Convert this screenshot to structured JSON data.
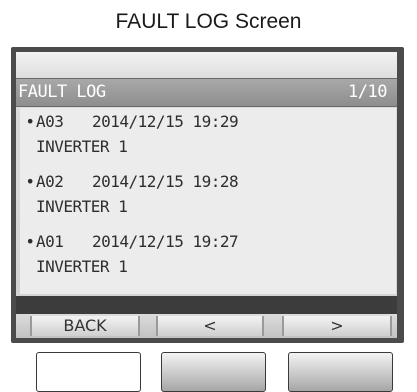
{
  "caption": "FAULT LOG Screen",
  "title_bar": {
    "title": "FAULT LOG",
    "page": "1/10"
  },
  "entries": [
    {
      "bullet": "•",
      "code": "A03",
      "timestamp": "2014/12/15 19:29",
      "source": "INVERTER 1"
    },
    {
      "bullet": "•",
      "code": "A02",
      "timestamp": "2014/12/15 19:28",
      "source": "INVERTER 1"
    },
    {
      "bullet": "•",
      "code": "A01",
      "timestamp": "2014/12/15 19:27",
      "source": "INVERTER 1"
    }
  ],
  "softkeys": {
    "back": "BACK",
    "prev": "<",
    "next": ">"
  },
  "colors": {
    "title_bar": "#9a9a9a",
    "screen_bg": "#ececec",
    "bezel": "#4b4b4b"
  }
}
